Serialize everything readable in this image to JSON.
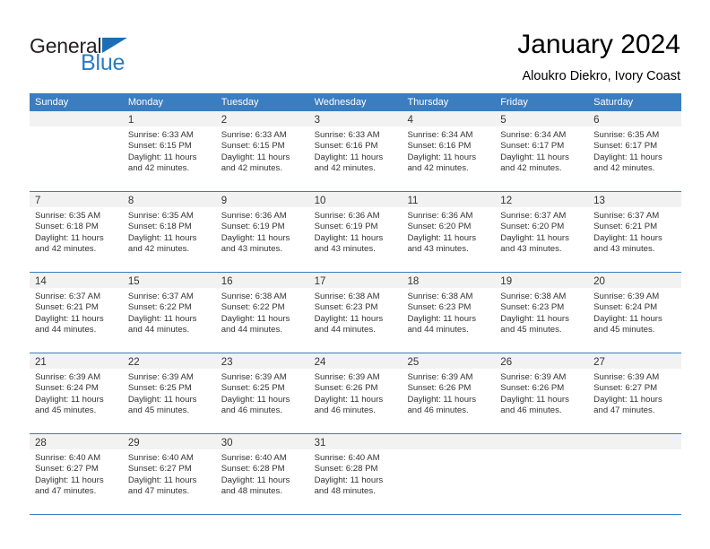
{
  "brand": {
    "name_dark": "General",
    "name_blue": "Blue",
    "accent_color": "#2b7cc4",
    "triangle_color": "#1c6fb5"
  },
  "header": {
    "title": "January 2024",
    "subtitle": "Aloukro Diekro, Ivory Coast"
  },
  "calendar": {
    "header_bg": "#3a7dc0",
    "daynum_bg": "#f2f2f2",
    "weekdays": [
      "Sunday",
      "Monday",
      "Tuesday",
      "Wednesday",
      "Thursday",
      "Friday",
      "Saturday"
    ],
    "weeks": [
      [
        {
          "day": "",
          "lines": []
        },
        {
          "day": "1",
          "lines": [
            "Sunrise: 6:33 AM",
            "Sunset: 6:15 PM",
            "Daylight: 11 hours",
            "and 42 minutes."
          ]
        },
        {
          "day": "2",
          "lines": [
            "Sunrise: 6:33 AM",
            "Sunset: 6:15 PM",
            "Daylight: 11 hours",
            "and 42 minutes."
          ]
        },
        {
          "day": "3",
          "lines": [
            "Sunrise: 6:33 AM",
            "Sunset: 6:16 PM",
            "Daylight: 11 hours",
            "and 42 minutes."
          ]
        },
        {
          "day": "4",
          "lines": [
            "Sunrise: 6:34 AM",
            "Sunset: 6:16 PM",
            "Daylight: 11 hours",
            "and 42 minutes."
          ]
        },
        {
          "day": "5",
          "lines": [
            "Sunrise: 6:34 AM",
            "Sunset: 6:17 PM",
            "Daylight: 11 hours",
            "and 42 minutes."
          ]
        },
        {
          "day": "6",
          "lines": [
            "Sunrise: 6:35 AM",
            "Sunset: 6:17 PM",
            "Daylight: 11 hours",
            "and 42 minutes."
          ]
        }
      ],
      [
        {
          "day": "7",
          "lines": [
            "Sunrise: 6:35 AM",
            "Sunset: 6:18 PM",
            "Daylight: 11 hours",
            "and 42 minutes."
          ]
        },
        {
          "day": "8",
          "lines": [
            "Sunrise: 6:35 AM",
            "Sunset: 6:18 PM",
            "Daylight: 11 hours",
            "and 42 minutes."
          ]
        },
        {
          "day": "9",
          "lines": [
            "Sunrise: 6:36 AM",
            "Sunset: 6:19 PM",
            "Daylight: 11 hours",
            "and 43 minutes."
          ]
        },
        {
          "day": "10",
          "lines": [
            "Sunrise: 6:36 AM",
            "Sunset: 6:19 PM",
            "Daylight: 11 hours",
            "and 43 minutes."
          ]
        },
        {
          "day": "11",
          "lines": [
            "Sunrise: 6:36 AM",
            "Sunset: 6:20 PM",
            "Daylight: 11 hours",
            "and 43 minutes."
          ]
        },
        {
          "day": "12",
          "lines": [
            "Sunrise: 6:37 AM",
            "Sunset: 6:20 PM",
            "Daylight: 11 hours",
            "and 43 minutes."
          ]
        },
        {
          "day": "13",
          "lines": [
            "Sunrise: 6:37 AM",
            "Sunset: 6:21 PM",
            "Daylight: 11 hours",
            "and 43 minutes."
          ]
        }
      ],
      [
        {
          "day": "14",
          "lines": [
            "Sunrise: 6:37 AM",
            "Sunset: 6:21 PM",
            "Daylight: 11 hours",
            "and 44 minutes."
          ]
        },
        {
          "day": "15",
          "lines": [
            "Sunrise: 6:37 AM",
            "Sunset: 6:22 PM",
            "Daylight: 11 hours",
            "and 44 minutes."
          ]
        },
        {
          "day": "16",
          "lines": [
            "Sunrise: 6:38 AM",
            "Sunset: 6:22 PM",
            "Daylight: 11 hours",
            "and 44 minutes."
          ]
        },
        {
          "day": "17",
          "lines": [
            "Sunrise: 6:38 AM",
            "Sunset: 6:23 PM",
            "Daylight: 11 hours",
            "and 44 minutes."
          ]
        },
        {
          "day": "18",
          "lines": [
            "Sunrise: 6:38 AM",
            "Sunset: 6:23 PM",
            "Daylight: 11 hours",
            "and 44 minutes."
          ]
        },
        {
          "day": "19",
          "lines": [
            "Sunrise: 6:38 AM",
            "Sunset: 6:23 PM",
            "Daylight: 11 hours",
            "and 45 minutes."
          ]
        },
        {
          "day": "20",
          "lines": [
            "Sunrise: 6:39 AM",
            "Sunset: 6:24 PM",
            "Daylight: 11 hours",
            "and 45 minutes."
          ]
        }
      ],
      [
        {
          "day": "21",
          "lines": [
            "Sunrise: 6:39 AM",
            "Sunset: 6:24 PM",
            "Daylight: 11 hours",
            "and 45 minutes."
          ]
        },
        {
          "day": "22",
          "lines": [
            "Sunrise: 6:39 AM",
            "Sunset: 6:25 PM",
            "Daylight: 11 hours",
            "and 45 minutes."
          ]
        },
        {
          "day": "23",
          "lines": [
            "Sunrise: 6:39 AM",
            "Sunset: 6:25 PM",
            "Daylight: 11 hours",
            "and 46 minutes."
          ]
        },
        {
          "day": "24",
          "lines": [
            "Sunrise: 6:39 AM",
            "Sunset: 6:26 PM",
            "Daylight: 11 hours",
            "and 46 minutes."
          ]
        },
        {
          "day": "25",
          "lines": [
            "Sunrise: 6:39 AM",
            "Sunset: 6:26 PM",
            "Daylight: 11 hours",
            "and 46 minutes."
          ]
        },
        {
          "day": "26",
          "lines": [
            "Sunrise: 6:39 AM",
            "Sunset: 6:26 PM",
            "Daylight: 11 hours",
            "and 46 minutes."
          ]
        },
        {
          "day": "27",
          "lines": [
            "Sunrise: 6:39 AM",
            "Sunset: 6:27 PM",
            "Daylight: 11 hours",
            "and 47 minutes."
          ]
        }
      ],
      [
        {
          "day": "28",
          "lines": [
            "Sunrise: 6:40 AM",
            "Sunset: 6:27 PM",
            "Daylight: 11 hours",
            "and 47 minutes."
          ]
        },
        {
          "day": "29",
          "lines": [
            "Sunrise: 6:40 AM",
            "Sunset: 6:27 PM",
            "Daylight: 11 hours",
            "and 47 minutes."
          ]
        },
        {
          "day": "30",
          "lines": [
            "Sunrise: 6:40 AM",
            "Sunset: 6:28 PM",
            "Daylight: 11 hours",
            "and 48 minutes."
          ]
        },
        {
          "day": "31",
          "lines": [
            "Sunrise: 6:40 AM",
            "Sunset: 6:28 PM",
            "Daylight: 11 hours",
            "and 48 minutes."
          ]
        },
        {
          "day": "",
          "lines": []
        },
        {
          "day": "",
          "lines": []
        },
        {
          "day": "",
          "lines": []
        }
      ]
    ]
  }
}
